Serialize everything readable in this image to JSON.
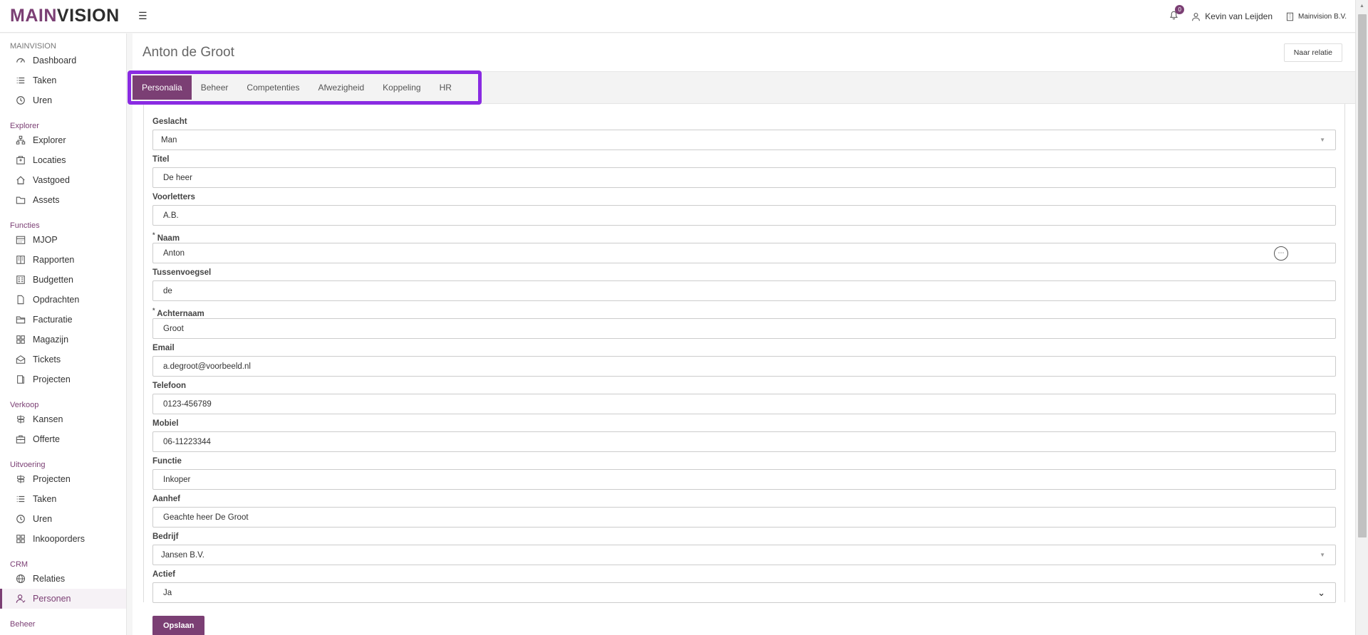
{
  "app": {
    "logo_part1": "MAIN",
    "logo_part2": "VISION",
    "notification_count": "0",
    "user_name": "Kevin van Leijden",
    "org_name": "Mainvision B.V."
  },
  "sidebar": {
    "sections": [
      {
        "title": "MAINVISION",
        "items": [
          {
            "label": "Dashboard",
            "icon": "dashboard-icon"
          },
          {
            "label": "Taken",
            "icon": "list-icon"
          },
          {
            "label": "Uren",
            "icon": "clock-icon"
          }
        ]
      },
      {
        "title": "Explorer",
        "items": [
          {
            "label": "Explorer",
            "icon": "sitemap-icon"
          },
          {
            "label": "Locaties",
            "icon": "building-icon"
          },
          {
            "label": "Vastgoed",
            "icon": "home-icon"
          },
          {
            "label": "Assets",
            "icon": "folder-icon"
          }
        ]
      },
      {
        "title": "Functies",
        "items": [
          {
            "label": "MJOP",
            "icon": "calendar-icon"
          },
          {
            "label": "Rapporten",
            "icon": "report-icon"
          },
          {
            "label": "Budgetten",
            "icon": "budget-icon"
          },
          {
            "label": "Opdrachten",
            "icon": "file-icon"
          },
          {
            "label": "Facturatie",
            "icon": "folder-open-icon"
          },
          {
            "label": "Magazijn",
            "icon": "grid-icon"
          },
          {
            "label": "Tickets",
            "icon": "envelope-open-icon"
          },
          {
            "label": "Projecten",
            "icon": "book-icon"
          }
        ]
      },
      {
        "title": "Verkoop",
        "items": [
          {
            "label": "Kansen",
            "icon": "signpost-icon"
          },
          {
            "label": "Offerte",
            "icon": "briefcase-icon"
          }
        ]
      },
      {
        "title": "Uitvoering",
        "items": [
          {
            "label": "Projecten",
            "icon": "signpost-icon"
          },
          {
            "label": "Taken",
            "icon": "list-icon"
          },
          {
            "label": "Uren",
            "icon": "clock-icon"
          },
          {
            "label": "Inkooporders",
            "icon": "grid-icon"
          }
        ]
      },
      {
        "title": "CRM",
        "items": [
          {
            "label": "Relaties",
            "icon": "globe-icon"
          },
          {
            "label": "Personen",
            "icon": "user-icon",
            "active": true
          }
        ]
      },
      {
        "title": "Beheer",
        "items": []
      }
    ]
  },
  "header": {
    "title": "Anton de Groot",
    "to_relation_label": "Naar relatie"
  },
  "tabs": [
    "Personalia",
    "Beheer",
    "Competenties",
    "Afwezigheid",
    "Koppeling",
    "HR"
  ],
  "form": {
    "geslacht": {
      "label": "Geslacht",
      "value": "Man"
    },
    "titel": {
      "label": "Titel",
      "value": "De heer"
    },
    "voorletters": {
      "label": "Voorletters",
      "value": "A.B."
    },
    "naam": {
      "label": "Naam",
      "value": "Anton"
    },
    "tussenvoegsel": {
      "label": "Tussenvoegsel",
      "value": "de"
    },
    "achternaam": {
      "label": "Achternaam",
      "value": "Groot"
    },
    "email": {
      "label": "Email",
      "value": "a.degroot@voorbeeld.nl"
    },
    "telefoon": {
      "label": "Telefoon",
      "value": "0123-456789"
    },
    "mobiel": {
      "label": "Mobiel",
      "value": "06-11223344"
    },
    "functie": {
      "label": "Functie",
      "value": "Inkoper"
    },
    "aanhef": {
      "label": "Aanhef",
      "value": "Geachte heer De Groot"
    },
    "bedrijf": {
      "label": "Bedrijf",
      "value": "Jansen B.V."
    },
    "actief": {
      "label": "Actief",
      "value": "Ja"
    },
    "save_label": "Opslaan",
    "required_mark": "*"
  },
  "colors": {
    "accent": "#7b3f74",
    "highlight": "#8a2be2"
  }
}
